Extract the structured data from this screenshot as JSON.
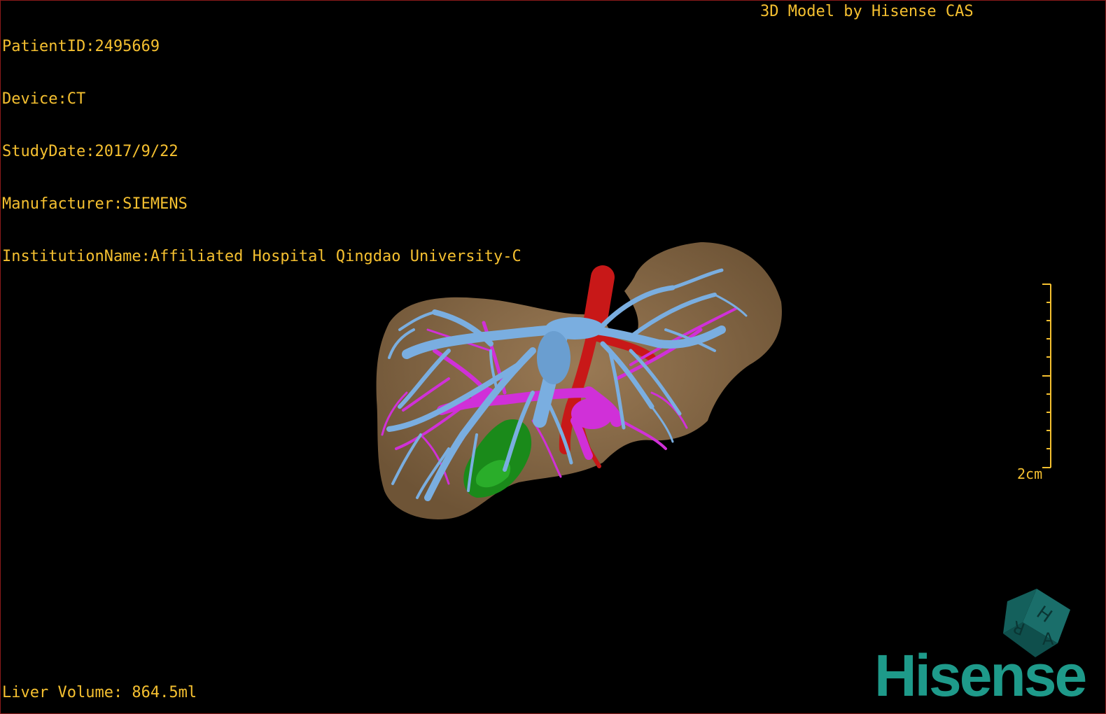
{
  "header": {
    "patient_id": "PatientID:2495669",
    "device": "Device:CT",
    "study_date": "StudyDate:2017/9/22",
    "manufacturer": "Manufacturer:SIEMENS",
    "institution": "InstitutionName:Affiliated Hospital Qingdao University-C"
  },
  "credit": "3D Model by Hisense CAS",
  "footer": {
    "liver_volume": "Liver Volume: 864.5ml"
  },
  "scale_bar": {
    "label": "2cm"
  },
  "orientation_cube": {
    "faces": [
      "H",
      "R",
      "A"
    ]
  },
  "logo": {
    "text": "Hisense"
  },
  "colors": {
    "text": "#f5c030",
    "liver": "#8c6d4a",
    "portal_vein": "#7aaee0",
    "hepatic_vessels": "#d030d8",
    "artery": "#c81818",
    "gallbladder": "#1a8a1a",
    "logo": "#1e9a8a"
  }
}
